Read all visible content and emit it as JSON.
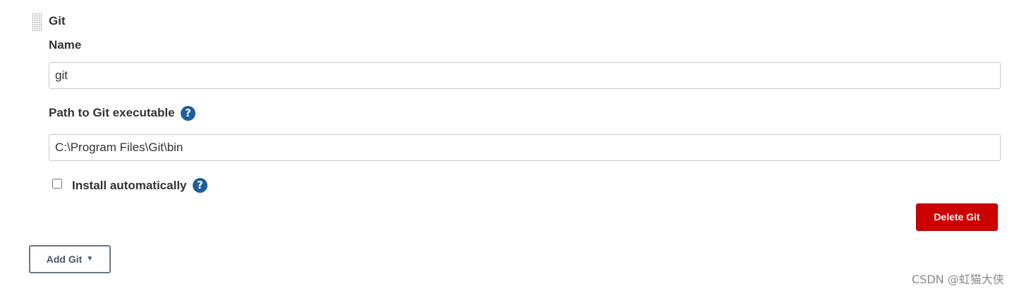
{
  "section": {
    "title": "Git"
  },
  "name_field": {
    "label": "Name",
    "value": "git"
  },
  "path_field": {
    "label": "Path to Git executable",
    "value": "C:\\Program Files\\Git\\bin",
    "help_icon": "question-mark-circle-icon",
    "help_glyph": "?"
  },
  "install_automatically": {
    "label": "Install automatically",
    "checked": false,
    "help_icon": "question-mark-circle-icon",
    "help_glyph": "?"
  },
  "buttons": {
    "delete_label": "Delete Git",
    "add_label": "Add Git",
    "add_caret_icon": "caret-down-icon",
    "add_caret_glyph": "▼"
  },
  "colors": {
    "delete_button": "#cc0000",
    "help_icon": "#1f5f99",
    "add_button_border": "#6b7886"
  },
  "watermark": {
    "text": "CSDN @虹猫大侠"
  }
}
